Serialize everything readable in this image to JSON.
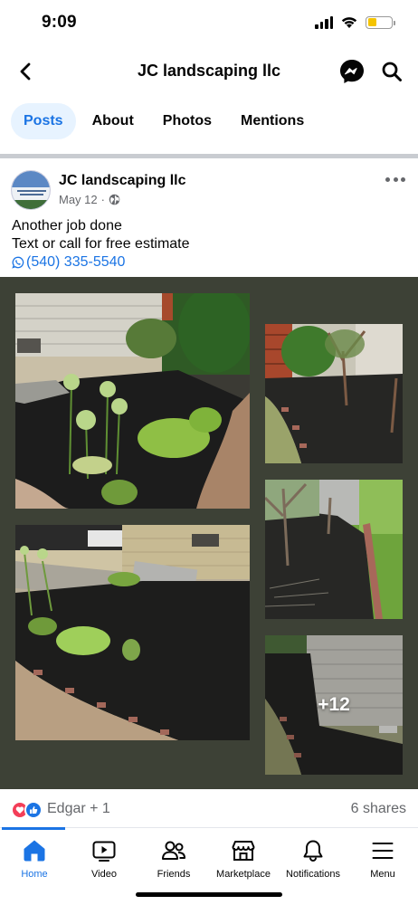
{
  "status_bar": {
    "time": "9:09",
    "battery_level": 0.3,
    "battery_color": "#f5c400",
    "icons": [
      "cellular-signal-icon",
      "wifi-icon",
      "battery-icon"
    ]
  },
  "header": {
    "title": "JC landscaping llc",
    "icons": [
      "back-arrow-icon",
      "messenger-icon",
      "search-icon"
    ]
  },
  "tabs": [
    {
      "label": "Posts",
      "active": true
    },
    {
      "label": "About",
      "active": false
    },
    {
      "label": "Photos",
      "active": false
    },
    {
      "label": "Mentions",
      "active": false
    }
  ],
  "post": {
    "author": "JC landscaping llc",
    "date": "May 12",
    "separator": "·",
    "privacy_icon": "globe-icon",
    "text_line1": "Another job done",
    "text_line2": "Text or call for free estimate",
    "phone": "(540) 335-5540",
    "phone_icon": "whatsapp-icon",
    "more_photos": "+12"
  },
  "reactions": {
    "names": "Edgar + 1",
    "shares": "6 shares",
    "icons": [
      "love-reaction-icon",
      "like-reaction-icon"
    ]
  },
  "bottom_nav": [
    {
      "label": "Home",
      "icon": "home-icon",
      "active": true
    },
    {
      "label": "Video",
      "icon": "video-icon",
      "active": false
    },
    {
      "label": "Friends",
      "icon": "friends-icon",
      "active": false
    },
    {
      "label": "Marketplace",
      "icon": "marketplace-icon",
      "active": false
    },
    {
      "label": "Notifications",
      "icon": "bell-icon",
      "active": false
    },
    {
      "label": "Menu",
      "icon": "menu-icon",
      "active": false
    }
  ],
  "colors": {
    "accent": "#1b74e4",
    "tab_active_bg": "#e7f3ff",
    "secondary_text": "#65676b",
    "photo_backdrop": "#3d4136"
  }
}
